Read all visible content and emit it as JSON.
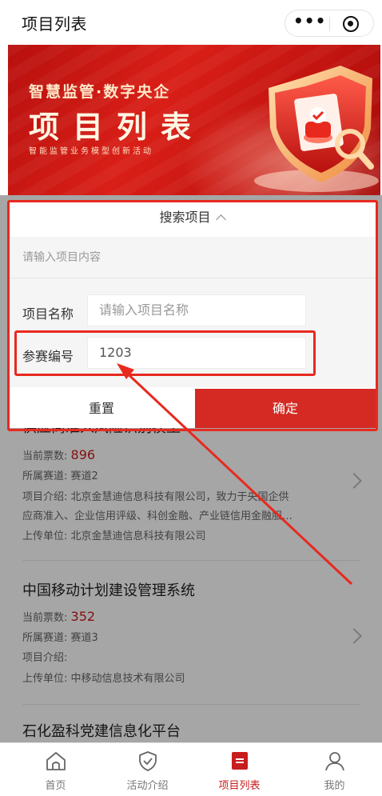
{
  "nav": {
    "title": "项目列表"
  },
  "banner": {
    "tagline": "智慧监管·数字央企",
    "title": "项目列表",
    "subtitle": "智能监管业务模型创新活动"
  },
  "search": {
    "header": "搜索项目",
    "content_placeholder": "请输入项目内容",
    "name_label": "项目名称",
    "name_placeholder": "请输入项目名称",
    "id_label": "参赛编号",
    "id_value": "1203",
    "reset_label": "重置",
    "confirm_label": "确定"
  },
  "items": [
    {
      "title_partial": "供应商准入风险识别模型",
      "votes_label": "当前票数:",
      "votes": "896",
      "track_label": "所属赛道:",
      "track": "赛道2",
      "intro_label": "项目介绍:",
      "intro_line1": "北京金慧迪信息科技有限公司，致力于央国企供",
      "intro_line2": "应商准入、企业信用评级、科创金融、产业链信用金融服…",
      "org_label": "上传单位:",
      "org": "北京金慧迪信息科技有限公司"
    },
    {
      "title": "中国移动计划建设管理系统",
      "votes_label": "当前票数:",
      "votes": "352",
      "track_label": "所属赛道:",
      "track": "赛道3",
      "intro_label": "项目介绍:",
      "org_label": "上传单位:",
      "org": "中移动信息技术有限公司"
    },
    {
      "title": "石化盈科党建信息化平台"
    }
  ],
  "tabbar": {
    "home": "首页",
    "intro": "活动介绍",
    "list": "项目列表",
    "mine": "我的"
  },
  "colors": {
    "brand_red": "#d42a23",
    "annotation_red": "#e8291e"
  }
}
